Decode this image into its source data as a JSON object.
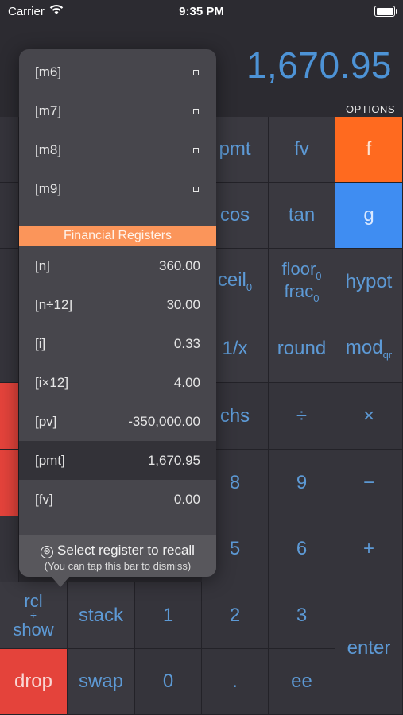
{
  "status": {
    "carrier": "Carrier",
    "time": "9:35 PM"
  },
  "display": {
    "value": "1,670.95",
    "options_label": "OPTIONS"
  },
  "keys": {
    "pmt": "pmt",
    "fv": "fv",
    "f": "f",
    "cos": "cos",
    "tan": "tan",
    "g": "g",
    "ceil": "ceil",
    "ceil_sub": "0",
    "floor": "floor",
    "floor_sub": "0",
    "frac": "frac",
    "frac_sub": "0",
    "hypot": "hypot",
    "reciprocal": "1/x",
    "round": "round",
    "mod": "mod",
    "mod_sub": "qr",
    "chs": "chs",
    "divide": "÷",
    "multiply": "×",
    "eight": "8",
    "nine": "9",
    "minus": "−",
    "five": "5",
    "six": "6",
    "plus": "+",
    "rcl": "rcl",
    "rcl_divider": "÷",
    "show": "show",
    "stack": "stack",
    "one": "1",
    "two": "2",
    "three": "3",
    "enter": "enter",
    "drop": "drop",
    "swap": "swap",
    "zero": "0",
    "dot": ".",
    "ee": "ee"
  },
  "popup": {
    "memory_rows": [
      {
        "label": "[m6]"
      },
      {
        "label": "[m7]"
      },
      {
        "label": "[m8]"
      },
      {
        "label": "[m9]"
      }
    ],
    "section_title": "Financial Registers",
    "financial_rows": [
      {
        "label": "[n]",
        "value": "360.00"
      },
      {
        "label": "[n÷12]",
        "value": "30.00"
      },
      {
        "label": "[i]",
        "value": "0.33"
      },
      {
        "label": "[i×12]",
        "value": "4.00"
      },
      {
        "label": "[pv]",
        "value": "-350,000.00"
      },
      {
        "label": "[pmt]",
        "value": "1,670.95"
      },
      {
        "label": "[fv]",
        "value": "0.00"
      }
    ],
    "footer_title": "Select register to recall",
    "footer_subtitle": "(You can tap this bar to dismiss)",
    "footer_icon": "⊗"
  },
  "colors": {
    "accent_blue": "#4d93d6",
    "orange_key": "#ff6a1f",
    "blue_key": "#3f8df2",
    "red_key": "#e4433b",
    "section_orange": "#fb955a"
  }
}
